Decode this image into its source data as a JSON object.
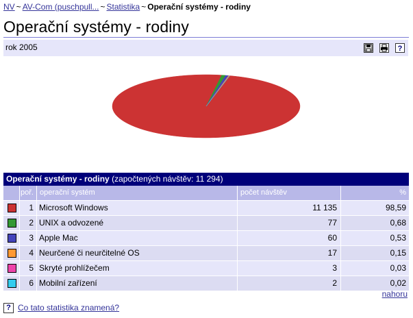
{
  "breadcrumb": {
    "items": [
      "NV",
      "AV-Com (puschpull...",
      "Statistika"
    ],
    "sep": "~",
    "current": "Operační systémy - rodiny"
  },
  "page": {
    "title": "Operační systémy - rodiny",
    "year": "rok 2005"
  },
  "toolbar": {
    "save_icon": "save-icon",
    "print_icon": "print-icon",
    "help_icon": "?"
  },
  "table": {
    "title": "Operační systémy - rodiny",
    "note": "(započtených návštěv: 11 294)",
    "headers": [
      "poř.",
      "operační systém",
      "počet návštěv",
      "%"
    ],
    "rows": [
      {
        "n": "1",
        "name": "Microsoft Windows",
        "visits": "11 135",
        "pct": "98,59",
        "color": "#cc3333"
      },
      {
        "n": "2",
        "name": "UNIX a odvozené",
        "visits": "77",
        "pct": "0,68",
        "color": "#339933"
      },
      {
        "n": "3",
        "name": "Apple Mac",
        "visits": "60",
        "pct": "0,53",
        "color": "#4444bb"
      },
      {
        "n": "4",
        "name": "Neurčené či neurčitelné OS",
        "visits": "17",
        "pct": "0,15",
        "color": "#ff9933"
      },
      {
        "n": "5",
        "name": "Skryté prohlížečem",
        "visits": "3",
        "pct": "0,03",
        "color": "#ee44aa"
      },
      {
        "n": "6",
        "name": "Mobilní zařízení",
        "visits": "2",
        "pct": "0,02",
        "color": "#33ccee"
      }
    ]
  },
  "chart_data": {
    "type": "pie",
    "categories": [
      "Microsoft Windows",
      "UNIX a odvozené",
      "Apple Mac",
      "Neurčené či neurčitelné OS",
      "Skryté prohlížečem",
      "Mobilní zařízení"
    ],
    "values": [
      98.59,
      0.68,
      0.53,
      0.15,
      0.03,
      0.02
    ],
    "colors": [
      "#cc3333",
      "#339933",
      "#4444bb",
      "#ff9933",
      "#ee44aa",
      "#33ccee"
    ]
  },
  "links": {
    "top": "nahoru",
    "help": "Co tato statistika znamená?"
  }
}
